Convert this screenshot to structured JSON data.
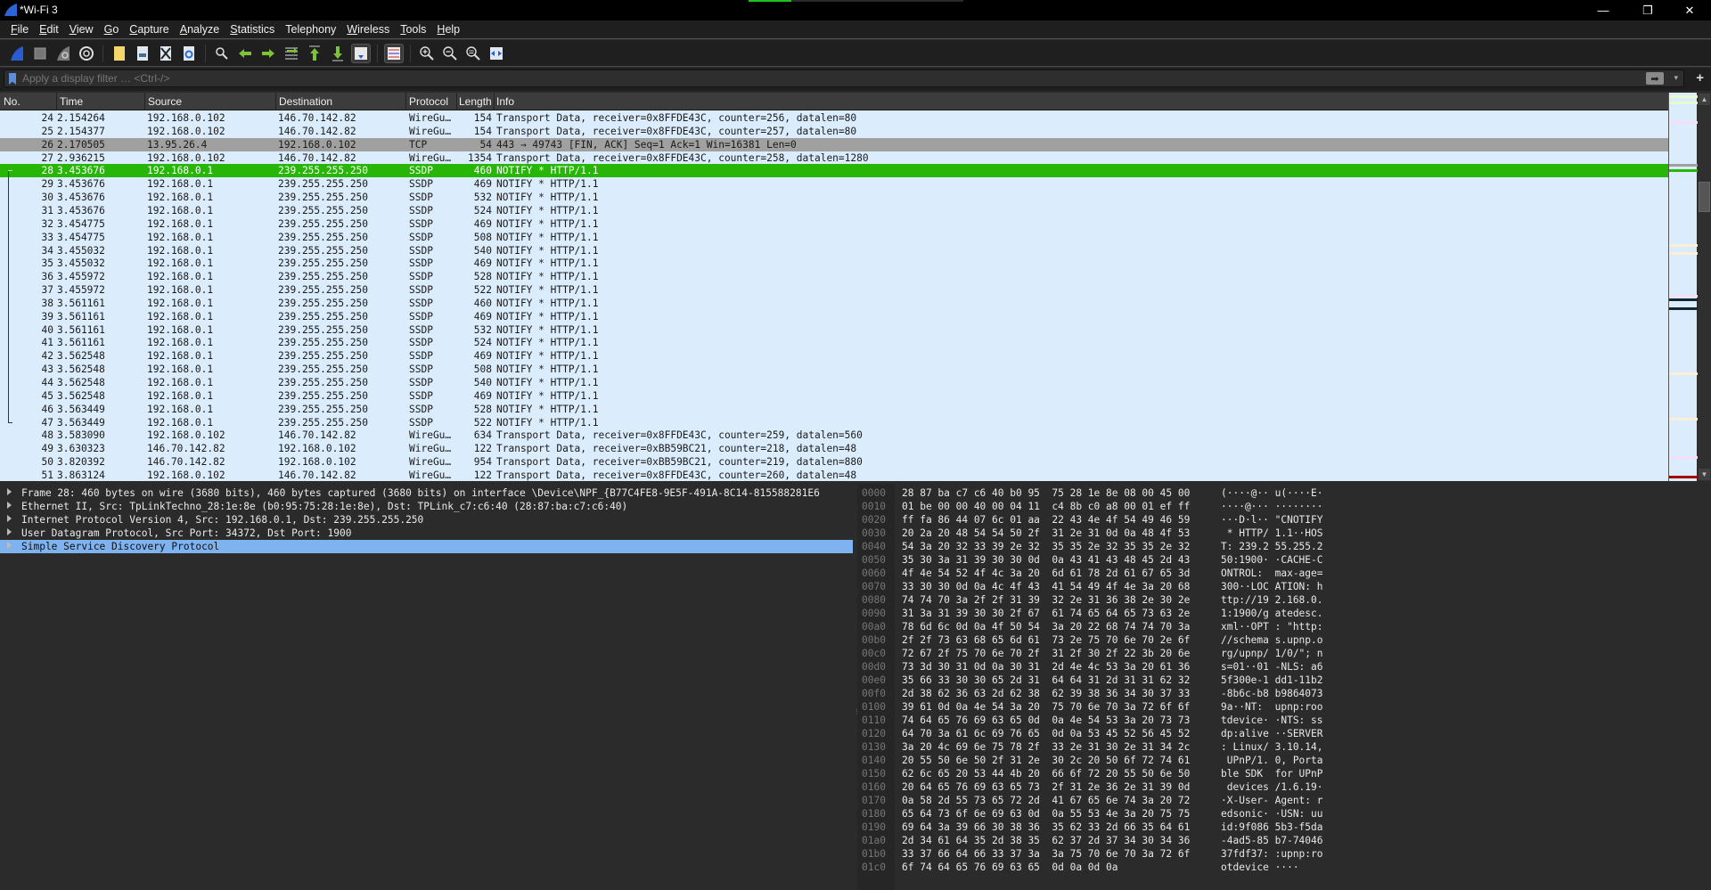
{
  "window": {
    "title": "*Wi-Fi 3",
    "capture_progress": 0.2,
    "controls": {
      "minimize": "—",
      "restore": "❐",
      "close": "✕"
    }
  },
  "menu": [
    {
      "label": "File",
      "mnemonic": "F",
      "rest": "ile"
    },
    {
      "label": "Edit",
      "mnemonic": "E",
      "rest": "dit"
    },
    {
      "label": "View",
      "mnemonic": "V",
      "rest": "iew"
    },
    {
      "label": "Go",
      "mnemonic": "G",
      "rest": "o"
    },
    {
      "label": "Capture",
      "mnemonic": "C",
      "rest": "apture"
    },
    {
      "label": "Analyze",
      "mnemonic": "A",
      "rest": "nalyze"
    },
    {
      "label": "Statistics",
      "mnemonic": "S",
      "rest": "tatistics"
    },
    {
      "label": "Telephony",
      "mnemonic": "",
      "rest": "Telephony"
    },
    {
      "label": "Wireless",
      "mnemonic": "W",
      "rest": "ireless"
    },
    {
      "label": "Tools",
      "mnemonic": "T",
      "rest": "ools"
    },
    {
      "label": "Help",
      "mnemonic": "H",
      "rest": "elp"
    }
  ],
  "toolbar": {
    "icons": [
      "start-capture-icon",
      "stop-capture-icon",
      "restart-capture-icon",
      "capture-options-icon",
      "open-file-icon",
      "save-file-icon",
      "close-file-icon",
      "reload-file-icon",
      "find-packet-icon",
      "go-back-icon",
      "go-forward-icon",
      "go-to-packet-icon",
      "first-packet-icon",
      "last-packet-icon",
      "auto-scroll-icon",
      "colorize-icon",
      "zoom-in-icon",
      "zoom-out-icon",
      "normal-size-icon",
      "resize-columns-icon"
    ]
  },
  "filter": {
    "placeholder": "Apply a display filter … <Ctrl-/>",
    "value": "",
    "apply_glyph": "➡",
    "dropdown_glyph": "▾",
    "add_glyph": "+"
  },
  "packet_list": {
    "columns": [
      "No.",
      "Time",
      "Source",
      "Destination",
      "Protocol",
      "Length",
      "Info"
    ],
    "rows": [
      {
        "no": "24",
        "time": "2.154264",
        "src": "192.168.0.102",
        "dst": "146.70.142.82",
        "proto": "WireGu…",
        "len": "154",
        "info": "Transport Data, receiver=0x8FFDE43C, counter=256, datalen=80",
        "style": "normal"
      },
      {
        "no": "25",
        "time": "2.154377",
        "src": "192.168.0.102",
        "dst": "146.70.142.82",
        "proto": "WireGu…",
        "len": "154",
        "info": "Transport Data, receiver=0x8FFDE43C, counter=257, datalen=80",
        "style": "normal"
      },
      {
        "no": "26",
        "time": "2.170505",
        "src": "13.95.26.4",
        "dst": "192.168.0.102",
        "proto": "TCP",
        "len": "54",
        "info": "443 → 49743 [FIN, ACK] Seq=1 Ack=1 Win=16381 Len=0",
        "style": "gray"
      },
      {
        "no": "27",
        "time": "2.936215",
        "src": "192.168.0.102",
        "dst": "146.70.142.82",
        "proto": "WireGu…",
        "len": "1354",
        "info": "Transport Data, receiver=0x8FFDE43C, counter=258, datalen=1280",
        "style": "normal"
      },
      {
        "no": "28",
        "time": "3.453676",
        "src": "192.168.0.1",
        "dst": "239.255.255.250",
        "proto": "SSDP",
        "len": "460",
        "info": "NOTIFY * HTTP/1.1",
        "style": "selected"
      },
      {
        "no": "29",
        "time": "3.453676",
        "src": "192.168.0.1",
        "dst": "239.255.255.250",
        "proto": "SSDP",
        "len": "469",
        "info": "NOTIFY * HTTP/1.1",
        "style": "normal"
      },
      {
        "no": "30",
        "time": "3.453676",
        "src": "192.168.0.1",
        "dst": "239.255.255.250",
        "proto": "SSDP",
        "len": "532",
        "info": "NOTIFY * HTTP/1.1",
        "style": "normal"
      },
      {
        "no": "31",
        "time": "3.453676",
        "src": "192.168.0.1",
        "dst": "239.255.255.250",
        "proto": "SSDP",
        "len": "524",
        "info": "NOTIFY * HTTP/1.1",
        "style": "normal"
      },
      {
        "no": "32",
        "time": "3.454775",
        "src": "192.168.0.1",
        "dst": "239.255.255.250",
        "proto": "SSDP",
        "len": "469",
        "info": "NOTIFY * HTTP/1.1",
        "style": "normal"
      },
      {
        "no": "33",
        "time": "3.454775",
        "src": "192.168.0.1",
        "dst": "239.255.255.250",
        "proto": "SSDP",
        "len": "508",
        "info": "NOTIFY * HTTP/1.1",
        "style": "normal"
      },
      {
        "no": "34",
        "time": "3.455032",
        "src": "192.168.0.1",
        "dst": "239.255.255.250",
        "proto": "SSDP",
        "len": "540",
        "info": "NOTIFY * HTTP/1.1",
        "style": "normal"
      },
      {
        "no": "35",
        "time": "3.455032",
        "src": "192.168.0.1",
        "dst": "239.255.255.250",
        "proto": "SSDP",
        "len": "469",
        "info": "NOTIFY * HTTP/1.1",
        "style": "normal"
      },
      {
        "no": "36",
        "time": "3.455972",
        "src": "192.168.0.1",
        "dst": "239.255.255.250",
        "proto": "SSDP",
        "len": "528",
        "info": "NOTIFY * HTTP/1.1",
        "style": "normal"
      },
      {
        "no": "37",
        "time": "3.455972",
        "src": "192.168.0.1",
        "dst": "239.255.255.250",
        "proto": "SSDP",
        "len": "522",
        "info": "NOTIFY * HTTP/1.1",
        "style": "normal"
      },
      {
        "no": "38",
        "time": "3.561161",
        "src": "192.168.0.1",
        "dst": "239.255.255.250",
        "proto": "SSDP",
        "len": "460",
        "info": "NOTIFY * HTTP/1.1",
        "style": "normal"
      },
      {
        "no": "39",
        "time": "3.561161",
        "src": "192.168.0.1",
        "dst": "239.255.255.250",
        "proto": "SSDP",
        "len": "469",
        "info": "NOTIFY * HTTP/1.1",
        "style": "normal"
      },
      {
        "no": "40",
        "time": "3.561161",
        "src": "192.168.0.1",
        "dst": "239.255.255.250",
        "proto": "SSDP",
        "len": "532",
        "info": "NOTIFY * HTTP/1.1",
        "style": "normal"
      },
      {
        "no": "41",
        "time": "3.561161",
        "src": "192.168.0.1",
        "dst": "239.255.255.250",
        "proto": "SSDP",
        "len": "524",
        "info": "NOTIFY * HTTP/1.1",
        "style": "normal"
      },
      {
        "no": "42",
        "time": "3.562548",
        "src": "192.168.0.1",
        "dst": "239.255.255.250",
        "proto": "SSDP",
        "len": "469",
        "info": "NOTIFY * HTTP/1.1",
        "style": "normal"
      },
      {
        "no": "43",
        "time": "3.562548",
        "src": "192.168.0.1",
        "dst": "239.255.255.250",
        "proto": "SSDP",
        "len": "508",
        "info": "NOTIFY * HTTP/1.1",
        "style": "normal"
      },
      {
        "no": "44",
        "time": "3.562548",
        "src": "192.168.0.1",
        "dst": "239.255.255.250",
        "proto": "SSDP",
        "len": "540",
        "info": "NOTIFY * HTTP/1.1",
        "style": "normal"
      },
      {
        "no": "45",
        "time": "3.562548",
        "src": "192.168.0.1",
        "dst": "239.255.255.250",
        "proto": "SSDP",
        "len": "469",
        "info": "NOTIFY * HTTP/1.1",
        "style": "normal"
      },
      {
        "no": "46",
        "time": "3.563449",
        "src": "192.168.0.1",
        "dst": "239.255.255.250",
        "proto": "SSDP",
        "len": "528",
        "info": "NOTIFY * HTTP/1.1",
        "style": "normal"
      },
      {
        "no": "47",
        "time": "3.563449",
        "src": "192.168.0.1",
        "dst": "239.255.255.250",
        "proto": "SSDP",
        "len": "522",
        "info": "NOTIFY * HTTP/1.1",
        "style": "normal"
      },
      {
        "no": "48",
        "time": "3.583090",
        "src": "192.168.0.102",
        "dst": "146.70.142.82",
        "proto": "WireGu…",
        "len": "634",
        "info": "Transport Data, receiver=0x8FFDE43C, counter=259, datalen=560",
        "style": "normal"
      },
      {
        "no": "49",
        "time": "3.630323",
        "src": "146.70.142.82",
        "dst": "192.168.0.102",
        "proto": "WireGu…",
        "len": "122",
        "info": "Transport Data, receiver=0xBB59BC21, counter=218, datalen=48",
        "style": "normal"
      },
      {
        "no": "50",
        "time": "3.820392",
        "src": "146.70.142.82",
        "dst": "192.168.0.102",
        "proto": "WireGu…",
        "len": "954",
        "info": "Transport Data, receiver=0xBB59BC21, counter=219, datalen=880",
        "style": "normal"
      },
      {
        "no": "51",
        "time": "3.863124",
        "src": "192.168.0.102",
        "dst": "146.70.142.82",
        "proto": "WireGu…",
        "len": "122",
        "info": "Transport Data, receiver=0x8FFDE43C, counter=260, datalen=48",
        "style": "normal"
      }
    ]
  },
  "minimap": {
    "marks": [
      {
        "pos": 0.02,
        "color": "#e4fcd0"
      },
      {
        "pos": 0.07,
        "color": "#e4fcd0"
      },
      {
        "pos": 0.22,
        "color": "#f8dcf8"
      },
      {
        "pos": 0.55,
        "color": "#a0a0a0"
      },
      {
        "pos": 0.59,
        "color": "#27b605"
      },
      {
        "pos": 1.17,
        "color": "#fbefd8"
      },
      {
        "pos": 1.23,
        "color": "#fbefd8"
      },
      {
        "pos": 1.56,
        "color": "#f8dcf8"
      },
      {
        "pos": 1.59,
        "color": "#12272e"
      },
      {
        "pos": 1.66,
        "color": "#12272e"
      },
      {
        "pos": 2.16,
        "color": "#fbefd8"
      },
      {
        "pos": 2.51,
        "color": "#fbefd8"
      },
      {
        "pos": 2.81,
        "color": "#f8dcf8"
      },
      {
        "pos": 2.96,
        "color": "#a40000"
      }
    ]
  },
  "details": {
    "items": [
      {
        "text": "Frame 28: 460 bytes on wire (3680 bits), 460 bytes captured (3680 bits) on interface \\Device\\NPF_{B77C4FE8-9E5F-491A-8C14-815588281E6",
        "selected": false
      },
      {
        "text": "Ethernet II, Src: TpLinkTechno_28:1e:8e (b0:95:75:28:1e:8e), Dst: TPLink_c7:c6:40 (28:87:ba:c7:c6:40)",
        "selected": false
      },
      {
        "text": "Internet Protocol Version 4, Src: 192.168.0.1, Dst: 239.255.255.250",
        "selected": false
      },
      {
        "text": "User Datagram Protocol, Src Port: 34372, Dst Port: 1900",
        "selected": false
      },
      {
        "text": "Simple Service Discovery Protocol",
        "selected": true
      }
    ]
  },
  "hex": {
    "rows": [
      {
        "off": "0000",
        "bytes": "28 87 ba c7 c6 40 b0 95  75 28 1e 8e 08 00 45 00",
        "ascii": "(····@·· u(····E·"
      },
      {
        "off": "0010",
        "bytes": "01 be 00 00 40 00 04 11  c4 8b c0 a8 00 01 ef ff",
        "ascii": "····@··· ········"
      },
      {
        "off": "0020",
        "bytes": "ff fa 86 44 07 6c 01 aa  22 43 4e 4f 54 49 46 59",
        "ascii": "···D·l·· \"CNOTIFY"
      },
      {
        "off": "0030",
        "bytes": "20 2a 20 48 54 54 50 2f  31 2e 31 0d 0a 48 4f 53",
        "ascii": " * HTTP/ 1.1··HOS"
      },
      {
        "off": "0040",
        "bytes": "54 3a 20 32 33 39 2e 32  35 35 2e 32 35 35 2e 32",
        "ascii": "T: 239.2 55.255.2"
      },
      {
        "off": "0050",
        "bytes": "35 30 3a 31 39 30 30 0d  0a 43 41 43 48 45 2d 43",
        "ascii": "50:1900· ·CACHE-C"
      },
      {
        "off": "0060",
        "bytes": "4f 4e 54 52 4f 4c 3a 20  6d 61 78 2d 61 67 65 3d",
        "ascii": "ONTROL:  max-age="
      },
      {
        "off": "0070",
        "bytes": "33 30 30 0d 0a 4c 4f 43  41 54 49 4f 4e 3a 20 68",
        "ascii": "300··LOC ATION: h"
      },
      {
        "off": "0080",
        "bytes": "74 74 70 3a 2f 2f 31 39  32 2e 31 36 38 2e 30 2e",
        "ascii": "ttp://19 2.168.0."
      },
      {
        "off": "0090",
        "bytes": "31 3a 31 39 30 30 2f 67  61 74 65 64 65 73 63 2e",
        "ascii": "1:1900/g atedesc."
      },
      {
        "off": "00a0",
        "bytes": "78 6d 6c 0d 0a 4f 50 54  3a 20 22 68 74 74 70 3a",
        "ascii": "xml··OPT : \"http:"
      },
      {
        "off": "00b0",
        "bytes": "2f 2f 73 63 68 65 6d 61  73 2e 75 70 6e 70 2e 6f",
        "ascii": "//schema s.upnp.o"
      },
      {
        "off": "00c0",
        "bytes": "72 67 2f 75 70 6e 70 2f  31 2f 30 2f 22 3b 20 6e",
        "ascii": "rg/upnp/ 1/0/\"; n"
      },
      {
        "off": "00d0",
        "bytes": "73 3d 30 31 0d 0a 30 31  2d 4e 4c 53 3a 20 61 36",
        "ascii": "s=01··01 -NLS: a6"
      },
      {
        "off": "00e0",
        "bytes": "35 66 33 30 30 65 2d 31  64 64 31 2d 31 31 62 32",
        "ascii": "5f300e-1 dd1-11b2"
      },
      {
        "off": "00f0",
        "bytes": "2d 38 62 36 63 2d 62 38  62 39 38 36 34 30 37 33",
        "ascii": "-8b6c-b8 b9864073"
      },
      {
        "off": "0100",
        "bytes": "39 61 0d 0a 4e 54 3a 20  75 70 6e 70 3a 72 6f 6f",
        "ascii": "9a··NT:  upnp:roo"
      },
      {
        "off": "0110",
        "bytes": "74 64 65 76 69 63 65 0d  0a 4e 54 53 3a 20 73 73",
        "ascii": "tdevice· ·NTS: ss"
      },
      {
        "off": "0120",
        "bytes": "64 70 3a 61 6c 69 76 65  0d 0a 53 45 52 56 45 52",
        "ascii": "dp:alive ··SERVER"
      },
      {
        "off": "0130",
        "bytes": "3a 20 4c 69 6e 75 78 2f  33 2e 31 30 2e 31 34 2c",
        "ascii": ": Linux/ 3.10.14,"
      },
      {
        "off": "0140",
        "bytes": "20 55 50 6e 50 2f 31 2e  30 2c 20 50 6f 72 74 61",
        "ascii": " UPnP/1. 0, Porta"
      },
      {
        "off": "0150",
        "bytes": "62 6c 65 20 53 44 4b 20  66 6f 72 20 55 50 6e 50",
        "ascii": "ble SDK  for UPnP"
      },
      {
        "off": "0160",
        "bytes": "20 64 65 76 69 63 65 73  2f 31 2e 36 2e 31 39 0d",
        "ascii": " devices /1.6.19·"
      },
      {
        "off": "0170",
        "bytes": "0a 58 2d 55 73 65 72 2d  41 67 65 6e 74 3a 20 72",
        "ascii": "·X-User- Agent: r"
      },
      {
        "off": "0180",
        "bytes": "65 64 73 6f 6e 69 63 0d  0a 55 53 4e 3a 20 75 75",
        "ascii": "edsonic· ·USN: uu"
      },
      {
        "off": "0190",
        "bytes": "69 64 3a 39 66 30 38 36  35 62 33 2d 66 35 64 61",
        "ascii": "id:9f086 5b3-f5da"
      },
      {
        "off": "01a0",
        "bytes": "2d 34 61 64 35 2d 38 35  62 37 2d 37 34 30 34 36",
        "ascii": "-4ad5-85 b7-74046"
      },
      {
        "off": "01b0",
        "bytes": "33 37 66 64 66 33 37 3a  3a 75 70 6e 70 3a 72 6f",
        "ascii": "37fdf37: :upnp:ro"
      },
      {
        "off": "01c0",
        "bytes": "6f 74 64 65 76 69 63 65  0d 0a 0d 0a",
        "ascii": "otdevice ····"
      }
    ]
  }
}
